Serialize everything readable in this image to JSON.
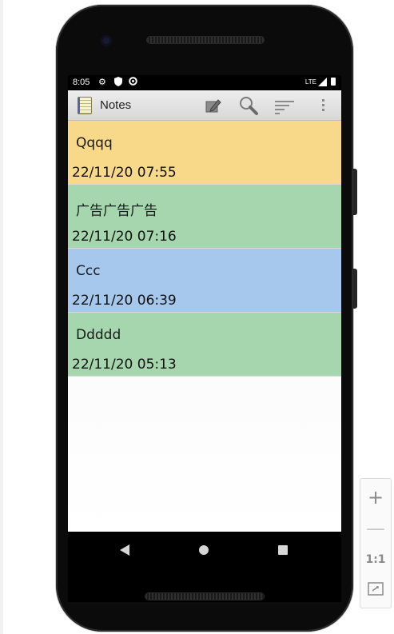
{
  "statusbar": {
    "time": "8:05",
    "network": "LTE"
  },
  "app": {
    "title": "Notes"
  },
  "actionbar": {
    "icons": [
      "edit-icon",
      "search-icon",
      "sort-icon",
      "more-icon"
    ]
  },
  "notes": [
    {
      "title": "Qqqq",
      "date": "22/11/20 07:55",
      "color": "#f8d889"
    },
    {
      "title": "广告广告广告",
      "date": "22/11/20 07:16",
      "color": "#a5d6ae"
    },
    {
      "title": "Ccc",
      "date": "22/11/20 06:39",
      "color": "#a6c8ec"
    },
    {
      "title": "Ddddd",
      "date": "22/11/20 05:13",
      "color": "#a5d6ae"
    }
  ],
  "emulator_controls": {
    "zoom_in": "+",
    "zoom_out": "—",
    "actual_size": "1:1"
  }
}
